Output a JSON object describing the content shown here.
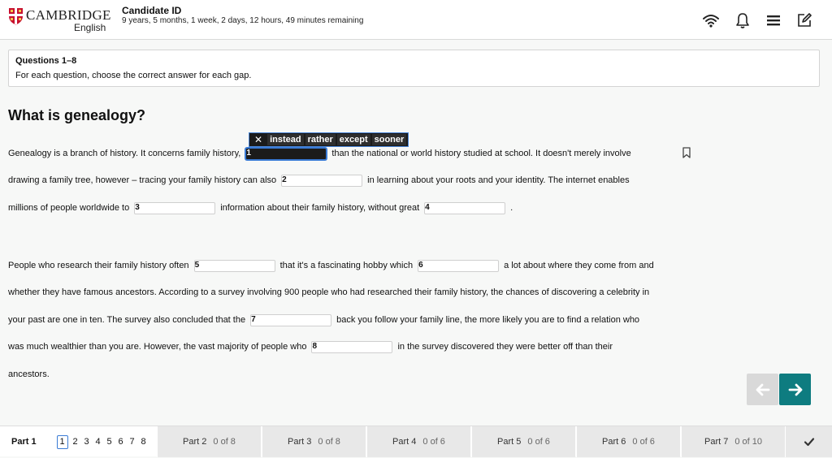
{
  "header": {
    "logo_text": "CAMBRIDGE",
    "logo_sub": "English",
    "candidate_title": "Candidate ID",
    "time_remaining": "9 years, 5 months, 1 week, 2 days, 12 hours, 49 minutes remaining"
  },
  "instructions": {
    "title": "Questions 1–8",
    "text": "For each question, choose the correct answer for each gap."
  },
  "passage_title": "What is genealogy?",
  "passage": {
    "l1a": "Genealogy is a branch of history. It concerns family history,",
    "g1": "1",
    "l1b": "than the national or world history studied at school. It doesn't merely involve",
    "l2a": "drawing a family tree, however – tracing your family history can also",
    "g2": "2",
    "l2b": "in learning about your roots and your identity. The internet enables",
    "l3a": "millions of people worldwide to",
    "g3": "3",
    "l3b": "information about their family history, without great",
    "g4": "4",
    "l3c": ".",
    "l4a": "People who research their family history often",
    "g5": "5",
    "l4b": "that it's a fascinating hobby which",
    "g6": "6",
    "l4c": "a lot about where they come from and",
    "l5": "whether they have famous ancestors. According to a survey involving 900 people who had researched their family history, the chances of discovering a celebrity in",
    "l6a": "your past are one in ten. The survey also concluded that the",
    "g7": "7",
    "l6b": "back you follow your family line, the more likely you are to find a relation who",
    "l7a": "was much wealthier than you are. However, the vast majority of people who",
    "g8": "8",
    "l7b": "in the survey discovered they were better off than their",
    "l8": "ancestors."
  },
  "options": {
    "close": "✕",
    "items": [
      "instead",
      "rather",
      "except",
      "sooner"
    ]
  },
  "footer": {
    "part1_label": "Part 1",
    "questions": [
      "1",
      "2",
      "3",
      "4",
      "5",
      "6",
      "7",
      "8"
    ],
    "parts": [
      {
        "name": "Part 2",
        "count": "0 of 8"
      },
      {
        "name": "Part 3",
        "count": "0 of 8"
      },
      {
        "name": "Part 4",
        "count": "0 of 6"
      },
      {
        "name": "Part 5",
        "count": "0 of 6"
      },
      {
        "name": "Part 6",
        "count": "0 of 6"
      },
      {
        "name": "Part 7",
        "count": "0 of 10"
      }
    ]
  },
  "colors": {
    "accent": "#0e7c80",
    "selection": "#3a7bd5",
    "logo_red": "#c8102e"
  },
  "icons": [
    "wifi-icon",
    "bell-icon",
    "menu-icon",
    "edit-icon",
    "bookmark-icon",
    "arrow-left-icon",
    "arrow-right-icon",
    "check-icon"
  ]
}
